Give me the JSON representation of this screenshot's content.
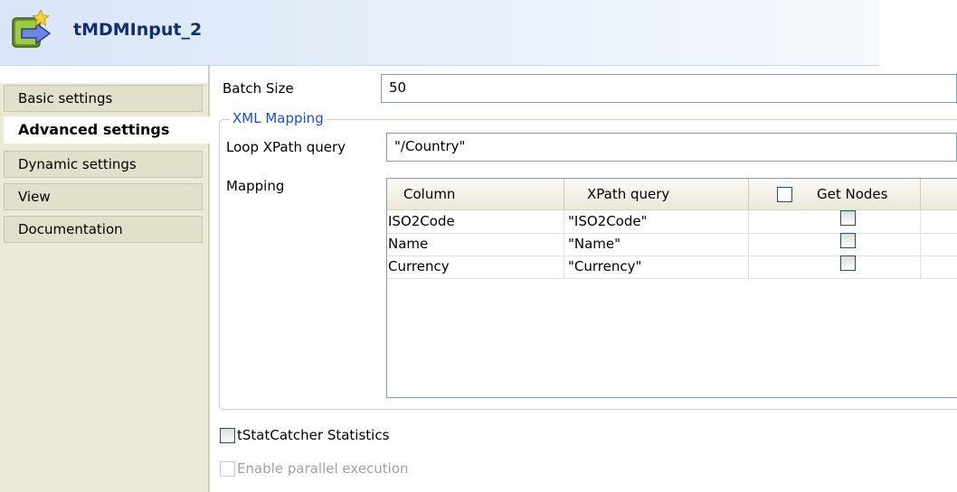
{
  "header": {
    "title": "tMDMInput_2",
    "icon": "tmdm-component-icon"
  },
  "sidebar": {
    "items": [
      {
        "label": "Basic settings",
        "active": false
      },
      {
        "label": "Advanced settings",
        "active": true
      },
      {
        "label": "Dynamic settings",
        "active": false
      },
      {
        "label": "View",
        "active": false
      },
      {
        "label": "Documentation",
        "active": false
      }
    ]
  },
  "main": {
    "batch_size_label": "Batch Size",
    "batch_size_value": "50",
    "xml_mapping": {
      "title": "XML Mapping",
      "loop_label": "Loop XPath query",
      "loop_value": "\"/Country\"",
      "mapping_label": "Mapping",
      "table": {
        "columns": [
          "Column",
          "XPath query",
          "Get Nodes"
        ],
        "rows": [
          {
            "column": "ISO2Code",
            "xpath": "\"ISO2Code\"",
            "get_nodes": false
          },
          {
            "column": "Name",
            "xpath": "\"Name\"",
            "get_nodes": false
          },
          {
            "column": "Currency",
            "xpath": "\"Currency\"",
            "get_nodes": false
          }
        ]
      }
    },
    "tstat_label": "tStatCatcher Statistics",
    "parallel_label": "Enable parallel execution"
  },
  "colors": {
    "group_title": "#1a4fd0",
    "sidebar_bg": "#ebe9d8",
    "checkbox_border": "#1c5180"
  }
}
